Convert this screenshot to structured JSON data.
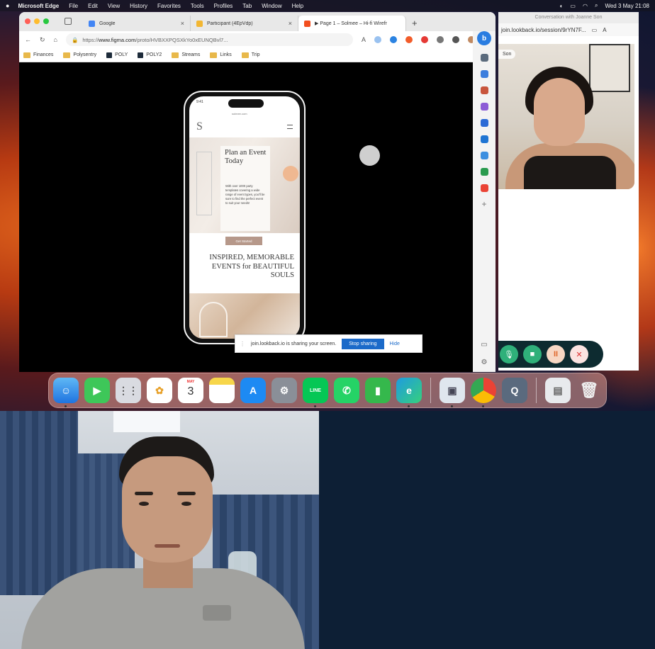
{
  "menubar": {
    "app": "Microsoft Edge",
    "items": [
      "File",
      "Edit",
      "View",
      "History",
      "Favorites",
      "Tools",
      "Profiles",
      "Tab",
      "Window",
      "Help"
    ],
    "datetime": "Wed 3 May  21:08"
  },
  "browser": {
    "tabs": [
      {
        "title": "Google",
        "icon_color": "#4285f4"
      },
      {
        "title": "Participant (4EpVdp)",
        "icon_color": "#f2b632"
      },
      {
        "title": "▶ Page 1 – Solmee – Hi-fi Wirefr",
        "icon_color": "#f24e1e"
      }
    ],
    "url_prefix": "https://",
    "url_host": "www.figma.com",
    "url_path": "/proto/HVBXXPQSXkYo0xEUNQBvl7...",
    "bookmarks": [
      "Finances",
      "Polysentry",
      "POLY",
      "POLY2",
      "Streams",
      "Links",
      "Trip"
    ]
  },
  "phone": {
    "time": "9:41",
    "mini_url": "solmee.com",
    "logo": "S",
    "hero_title": "Plan an Event Today",
    "hero_body": "With over 1000 party templates covering a wide range of event types, you'll be sure to find the perfect event to suit your needs!",
    "hero_button": "Get Started",
    "inspired": "INSPIRED, MEMORABLE EVENTS for BEAUTIFUL SOULS"
  },
  "share_bar": {
    "message": "join.lookback.io is sharing your screen.",
    "stop_label": "Stop sharing",
    "hide_label": "Hide"
  },
  "lookback": {
    "window_title": "Conversation with Joanne Son",
    "address": "join.lookback.io/session/9rYN7F...",
    "name_pill": "Son",
    "controls": [
      "mic-icon",
      "camera-icon",
      "pause-icon",
      "end-call-icon"
    ],
    "colors": {
      "controls_bg": "#0d2b30",
      "active": "#2fb07a",
      "end": "#d33"
    }
  },
  "dock": {
    "calendar_month": "MAY",
    "calendar_day": "3",
    "apps": [
      "Finder",
      "FaceTime",
      "Launchpad",
      "Photos",
      "Calendar",
      "Notes",
      "App Store",
      "System Settings",
      "LINE",
      "WhatsApp",
      "Numbers",
      "Microsoft Edge",
      "Preview",
      "Google Chrome",
      "QuickTime Player",
      "Documents",
      "Trash"
    ],
    "line_label": "LINE"
  }
}
